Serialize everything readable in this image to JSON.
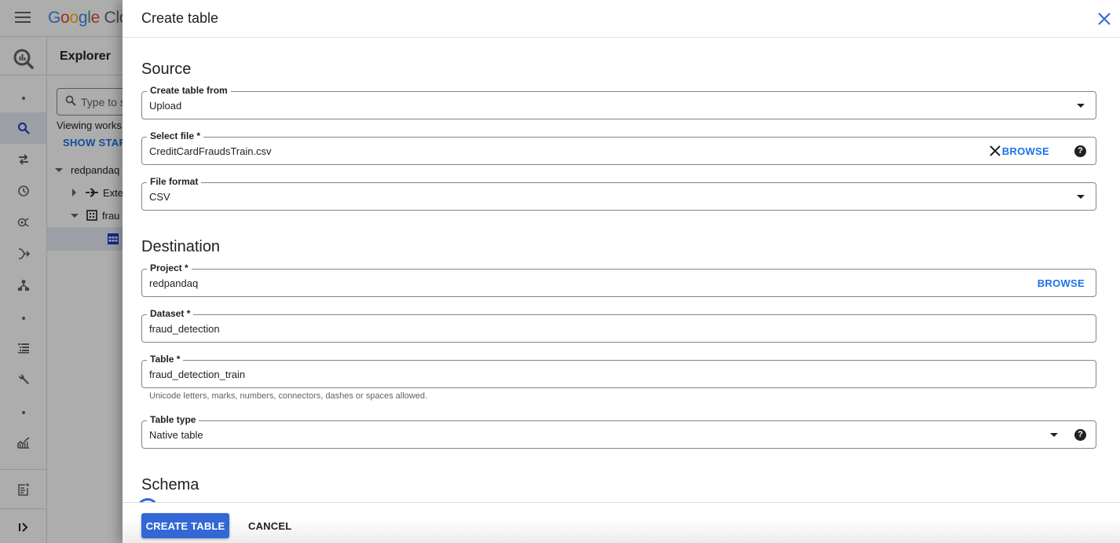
{
  "app": {
    "brand": {
      "g1": "G",
      "o1": "o",
      "o2": "o",
      "g2": "g",
      "l": "l",
      "e": "e",
      "cloud": "Clo"
    }
  },
  "explorer": {
    "title": "Explorer",
    "search_placeholder": "Type to se",
    "viewing_text": "Viewing works",
    "show_starred_label": "SHOW STARR",
    "tree": [
      {
        "label": "redpandaq",
        "expanded": true
      },
      {
        "label": "Exte",
        "expanded": false
      },
      {
        "label": "frau",
        "expanded": true
      },
      {
        "label": "",
        "selected": true
      }
    ]
  },
  "rail": {
    "items": [
      {
        "icon": "bigquery-icon"
      },
      {
        "icon": "dot-icon"
      },
      {
        "icon": "search-icon",
        "active": true
      },
      {
        "icon": "transfers-icon"
      },
      {
        "icon": "history-icon"
      },
      {
        "icon": "analytics-hub-icon"
      },
      {
        "icon": "dataflow-icon"
      },
      {
        "icon": "hierarchy-icon"
      },
      {
        "icon": "dot-icon"
      },
      {
        "icon": "list-icon"
      },
      {
        "icon": "wrench-icon"
      },
      {
        "icon": "dot-icon"
      },
      {
        "icon": "monitoring-chart-icon"
      },
      {
        "icon": "release-notes-icon"
      },
      {
        "icon": "expand-panel-icon"
      }
    ]
  },
  "dialog": {
    "title": "Create table",
    "close_icon": "close-icon",
    "sections": {
      "source": "Source",
      "destination": "Destination",
      "schema": "Schema"
    },
    "source": {
      "create_from": {
        "label": "Create table from",
        "value": "Upload"
      },
      "select_file": {
        "label": "Select file *",
        "value": "CreditCardFraudsTrain.csv",
        "browse": "BROWSE"
      },
      "file_format": {
        "label": "File format",
        "value": "CSV"
      }
    },
    "destination": {
      "project": {
        "label": "Project *",
        "value": "redpandaq",
        "browse": "BROWSE"
      },
      "dataset": {
        "label": "Dataset *",
        "value": "fraud_detection"
      },
      "table": {
        "label": "Table *",
        "value": "fraud_detection_train",
        "hint": "Unicode letters, marks, numbers, connectors, dashes or spaces allowed."
      },
      "table_type": {
        "label": "Table type",
        "value": "Native table"
      }
    },
    "footer": {
      "create_label": "CREATE TABLE",
      "cancel_label": "CANCEL"
    },
    "colors": {
      "primary": "#3367d6",
      "link": "#1a73e8"
    }
  }
}
